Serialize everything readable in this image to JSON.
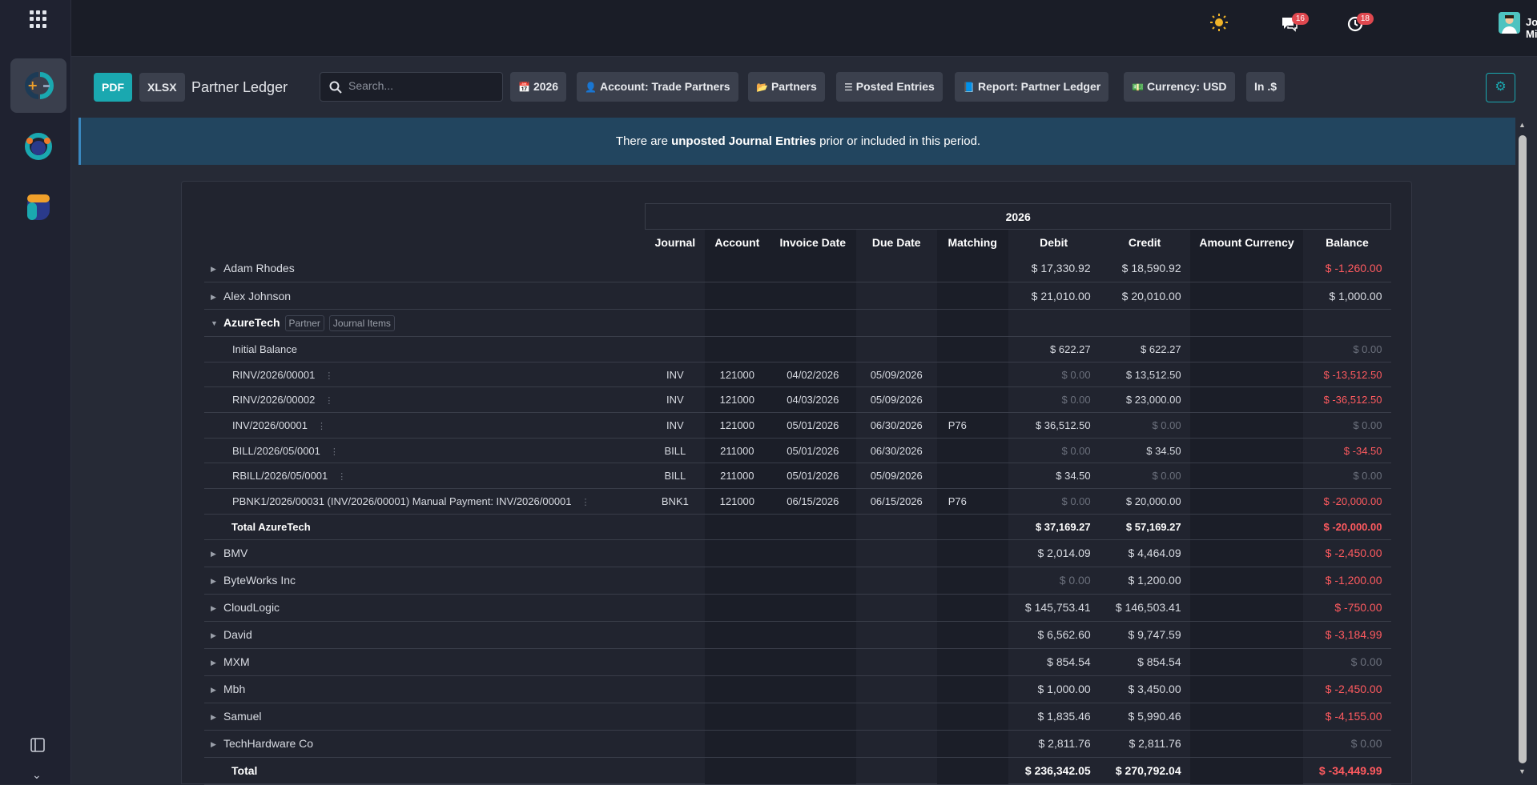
{
  "topbar": {
    "notif_messages": "16",
    "notif_activities": "18",
    "user_name": "Jordan Miles"
  },
  "control_panel": {
    "pdf_label": "PDF",
    "xlsx_label": "XLSX",
    "title": "Partner Ledger",
    "search_placeholder": "Search...",
    "filters": [
      {
        "icon": "calendar-icon",
        "label": "2026"
      },
      {
        "icon": "user-icon",
        "label": "Account: Trade Partners"
      },
      {
        "icon": "folder-icon",
        "label": "Partners"
      },
      {
        "icon": "sliders-icon",
        "label": "Posted Entries"
      },
      {
        "icon": "book-icon",
        "label": "Report: Partner Ledger"
      },
      {
        "icon": "money-icon",
        "label": "Currency: USD"
      },
      {
        "icon": "",
        "label": "In .$"
      }
    ]
  },
  "alert": {
    "before": "There are ",
    "strong": "unposted Journal Entries",
    "after": " prior or included in this period."
  },
  "report": {
    "year_header": "2026",
    "columns": [
      "Journal",
      "Account",
      "Invoice Date",
      "Due Date",
      "Matching",
      "Debit",
      "Credit",
      "Amount Currency",
      "Balance"
    ],
    "partners_before": [
      {
        "name": "Adam Rhodes",
        "debit": "$ 17,330.92",
        "credit": "$ 18,590.92",
        "balance": "$ -1,260.00"
      },
      {
        "name": "Alex Johnson",
        "debit": "$ 21,010.00",
        "credit": "$ 20,010.00",
        "balance": "$ 1,000.00"
      }
    ],
    "expanded": {
      "name": "AzureTech",
      "tag_partner": "Partner",
      "tag_items": "Journal Items",
      "initial": {
        "label": "Initial Balance",
        "debit": "$ 622.27",
        "credit": "$ 622.27",
        "balance": "$ 0.00"
      },
      "lines": [
        {
          "ref": "RINV/2026/00001",
          "journal": "INV",
          "account": "121000",
          "invoice_date": "04/02/2026",
          "due_date": "05/09/2026",
          "matching": "",
          "debit": "$ 0.00",
          "credit": "$ 13,512.50",
          "balance": "$ -13,512.50"
        },
        {
          "ref": "RINV/2026/00002",
          "journal": "INV",
          "account": "121000",
          "invoice_date": "04/03/2026",
          "due_date": "05/09/2026",
          "matching": "",
          "debit": "$ 0.00",
          "credit": "$ 23,000.00",
          "balance": "$ -36,512.50"
        },
        {
          "ref": "INV/2026/00001",
          "journal": "INV",
          "account": "121000",
          "invoice_date": "05/01/2026",
          "due_date": "06/30/2026",
          "matching": "P76",
          "debit": "$ 36,512.50",
          "credit": "$ 0.00",
          "balance": "$ 0.00"
        },
        {
          "ref": "BILL/2026/05/0001",
          "journal": "BILL",
          "account": "211000",
          "invoice_date": "05/01/2026",
          "due_date": "06/30/2026",
          "matching": "",
          "debit": "$ 0.00",
          "credit": "$ 34.50",
          "balance": "$ -34.50"
        },
        {
          "ref": "RBILL/2026/05/0001",
          "journal": "BILL",
          "account": "211000",
          "invoice_date": "05/01/2026",
          "due_date": "05/09/2026",
          "matching": "",
          "debit": "$ 34.50",
          "credit": "$ 0.00",
          "balance": "$ 0.00"
        },
        {
          "ref": "PBNK1/2026/00031 (INV/2026/00001) Manual Payment: INV/2026/00001",
          "journal": "BNK1",
          "account": "121000",
          "invoice_date": "06/15/2026",
          "due_date": "06/15/2026",
          "matching": "P76",
          "debit": "$ 0.00",
          "credit": "$ 20,000.00",
          "balance": "$ -20,000.00"
        }
      ],
      "total": {
        "label": "Total AzureTech",
        "debit": "$ 37,169.27",
        "credit": "$ 57,169.27",
        "balance": "$ -20,000.00"
      }
    },
    "partners_after": [
      {
        "name": "BMV",
        "debit": "$ 2,014.09",
        "credit": "$ 4,464.09",
        "balance": "$ -2,450.00"
      },
      {
        "name": "ByteWorks Inc",
        "debit": "$ 0.00",
        "credit": "$ 1,200.00",
        "balance": "$ -1,200.00"
      },
      {
        "name": "CloudLogic",
        "debit": "$ 145,753.41",
        "credit": "$ 146,503.41",
        "balance": "$ -750.00"
      },
      {
        "name": "David",
        "debit": "$ 6,562.60",
        "credit": "$ 9,747.59",
        "balance": "$ -3,184.99"
      },
      {
        "name": "MXM",
        "debit": "$ 854.54",
        "credit": "$ 854.54",
        "balance": "$ 0.00"
      },
      {
        "name": "Mbh",
        "debit": "$ 1,000.00",
        "credit": "$ 3,450.00",
        "balance": "$ -2,450.00"
      },
      {
        "name": "Samuel",
        "debit": "$ 1,835.46",
        "credit": "$ 5,990.46",
        "balance": "$ -4,155.00"
      },
      {
        "name": "TechHardware Co",
        "debit": "$ 2,811.76",
        "credit": "$ 2,811.76",
        "balance": "$ 0.00"
      }
    ],
    "grand_total": {
      "label": "Total",
      "debit": "$ 236,342.05",
      "credit": "$ 270,792.04",
      "balance": "$ -34,449.99"
    }
  },
  "colors": {
    "accent": "#1aa8b0",
    "negative": "#ff5a5f",
    "alert_bg": "#22455f",
    "badge": "#e0484f"
  }
}
